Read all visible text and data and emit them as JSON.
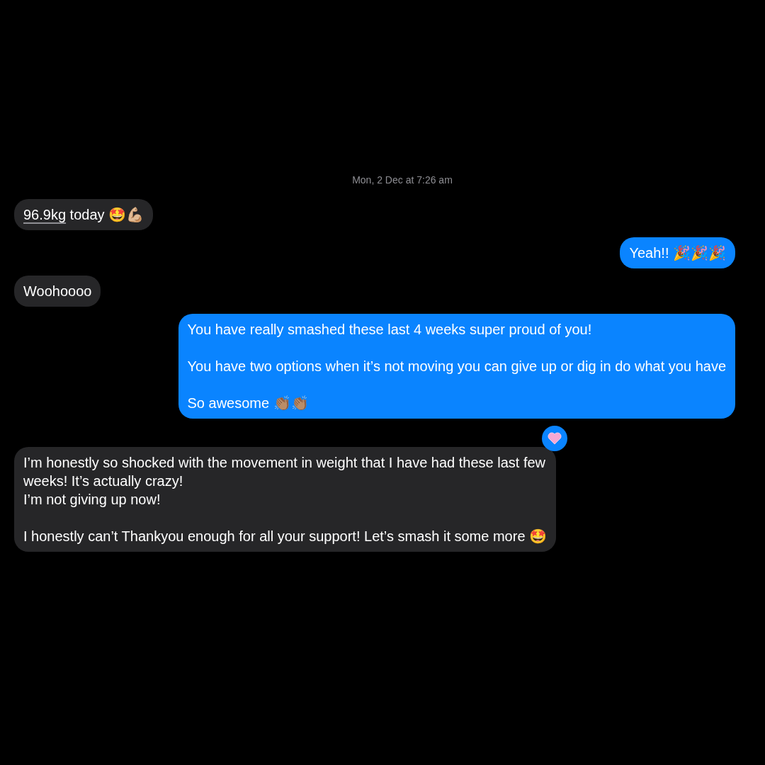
{
  "timestamp": {
    "day": "Mon, 2 Dec",
    "time": "at 7:26 am"
  },
  "messages": [
    {
      "kind": "received",
      "link": "96.9kg",
      "paragraphs": [
        " today 🤩💪🏼"
      ],
      "tapback": false
    },
    {
      "kind": "sent",
      "paragraphs": [
        "Yeah!! 🎉🎉🎉"
      ],
      "tapback": false
    },
    {
      "kind": "received",
      "paragraphs": [
        "Woohoooo"
      ],
      "tapback": false
    },
    {
      "kind": "sent",
      "paragraphs": [
        "You have really smashed these last 4 weeks super proud of you!",
        "You have two options when it’s not moving you can give up or dig in do what you have",
        "So awesome 👏🏽👏🏽"
      ],
      "tapback": false
    },
    {
      "kind": "received",
      "paragraphs": [
        "I’m honestly so shocked with the movement in weight that I have had these last few\nweeks! It’s actually crazy!\nI’m not giving up now!",
        "I honestly can’t Thankyou enough for all your support! Let’s smash it some more 🤩"
      ],
      "tapback": true
    }
  ]
}
